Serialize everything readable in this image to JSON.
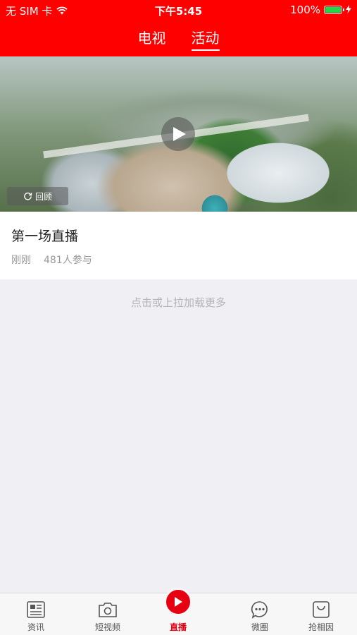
{
  "status_bar": {
    "carrier": "无 SIM 卡",
    "time": "下午5:45",
    "battery_percent": "100%",
    "battery_level": 1.0,
    "icons": [
      "wifi-icon",
      "battery-icon",
      "charging-icon"
    ]
  },
  "top_tabs": [
    {
      "label": "电视",
      "active": false
    },
    {
      "label": "活动",
      "active": true
    }
  ],
  "live_item": {
    "replay_label": "回顾",
    "title": "第一场直播",
    "time": "刚刚",
    "participants": "481人参与"
  },
  "load_more": "点击或上拉加载更多",
  "bottom_tabs": [
    {
      "label": "资讯",
      "icon": "news-icon",
      "active": false
    },
    {
      "label": "短视频",
      "icon": "camera-icon",
      "active": false
    },
    {
      "label": "直播",
      "icon": "live-play-icon",
      "active": true
    },
    {
      "label": "微圈",
      "icon": "chat-bubble-icon",
      "active": false
    },
    {
      "label": "抢相因",
      "icon": "shopping-bag-icon",
      "active": false
    }
  ],
  "colors": {
    "brand_red": "#ff0000",
    "active_tab_red": "#e60012",
    "background": "#efeff4"
  }
}
